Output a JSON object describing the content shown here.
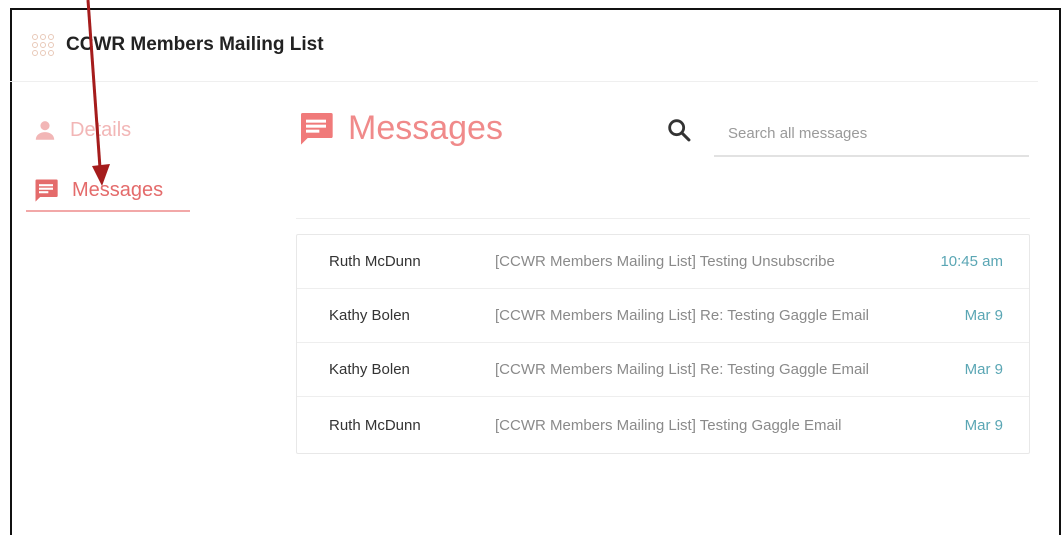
{
  "app": {
    "title": "CCWR Members Mailing List"
  },
  "sidebar": {
    "items": [
      {
        "label": "Details",
        "icon": "person-icon",
        "active": false
      },
      {
        "label": "Messages",
        "icon": "message-icon",
        "active": true
      }
    ]
  },
  "main": {
    "title": "Messages"
  },
  "search": {
    "placeholder": "Search all messages",
    "value": ""
  },
  "messages": [
    {
      "sender": "Ruth McDunn",
      "subject": "[CCWR Members Mailing List] Testing Unsubscribe",
      "date": "10:45 am"
    },
    {
      "sender": "Kathy Bolen",
      "subject": "[CCWR Members Mailing List] Re: Testing Gaggle Email",
      "date": "Mar 9"
    },
    {
      "sender": "Kathy Bolen",
      "subject": "[CCWR Members Mailing List] Re: Testing Gaggle Email",
      "date": "Mar 9"
    },
    {
      "sender": "Ruth McDunn",
      "subject": "[CCWR Members Mailing List] Testing Gaggle Email",
      "date": "Mar 9"
    }
  ],
  "colors": {
    "accent": "#e46b6b",
    "accent_light": "#f2b6b6",
    "date": "#5aa6b4",
    "annotation_arrow": "#a51c1c"
  }
}
